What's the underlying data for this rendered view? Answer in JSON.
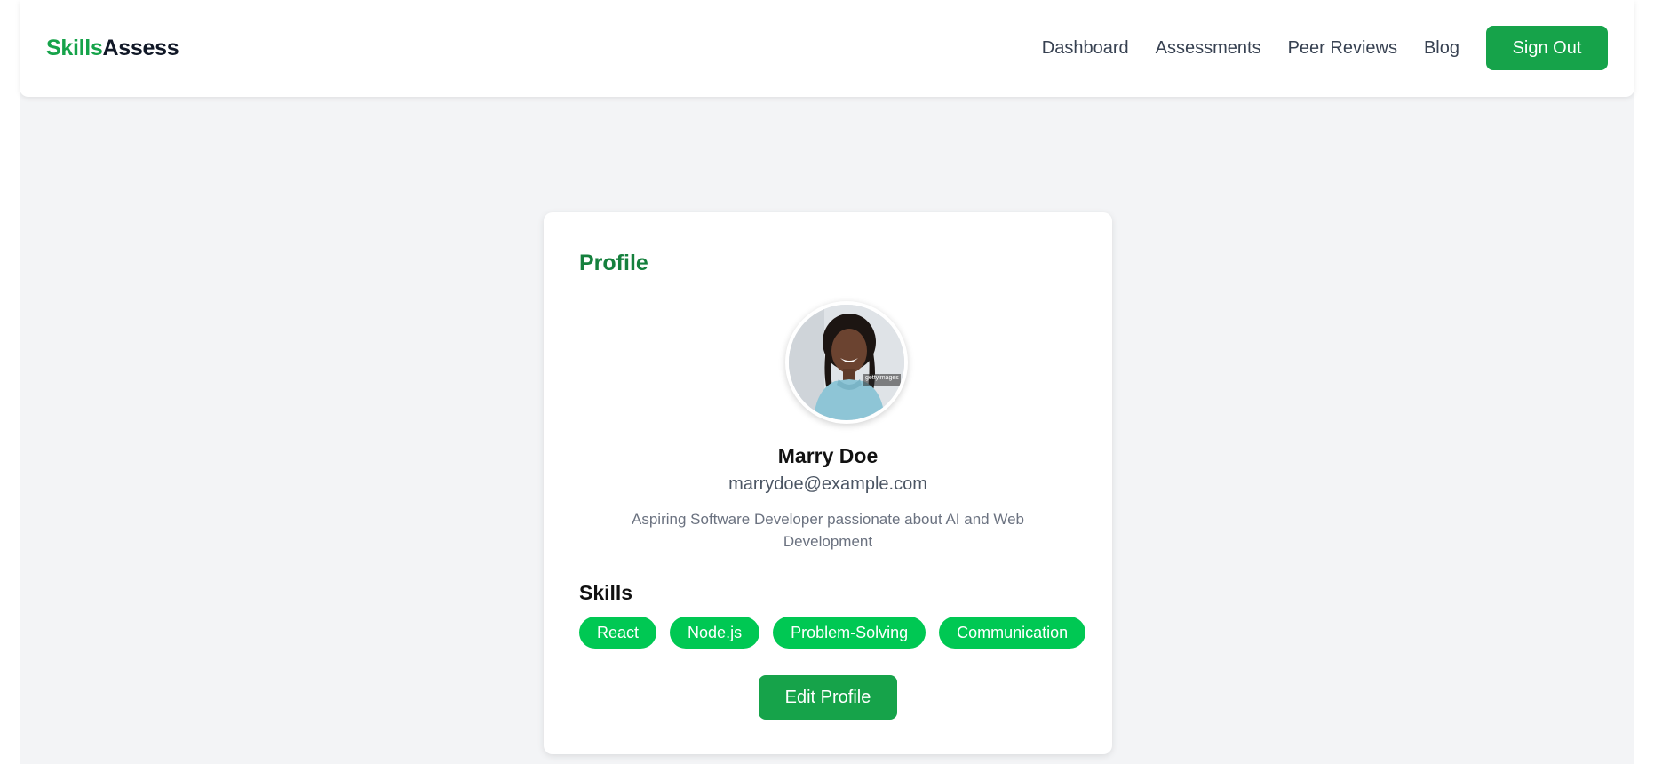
{
  "brand": {
    "part1": "Skills",
    "part2": "Assess"
  },
  "nav": {
    "links": [
      "Dashboard",
      "Assessments",
      "Peer Reviews",
      "Blog"
    ],
    "signout_label": "Sign Out"
  },
  "profile": {
    "title": "Profile",
    "avatar_watermark": "gettyimages",
    "name": "Marry Doe",
    "email": "marrydoe@example.com",
    "bio": "Aspiring Software Developer passionate about AI and Web Development",
    "skills_title": "Skills",
    "skills": [
      "React",
      "Node.js",
      "Problem-Solving",
      "Communication"
    ],
    "edit_label": "Edit Profile"
  },
  "colors": {
    "brand_green": "#16a34a",
    "title_green": "#15803d",
    "skill_green": "#00c853",
    "page_bg": "#f3f4f6"
  }
}
